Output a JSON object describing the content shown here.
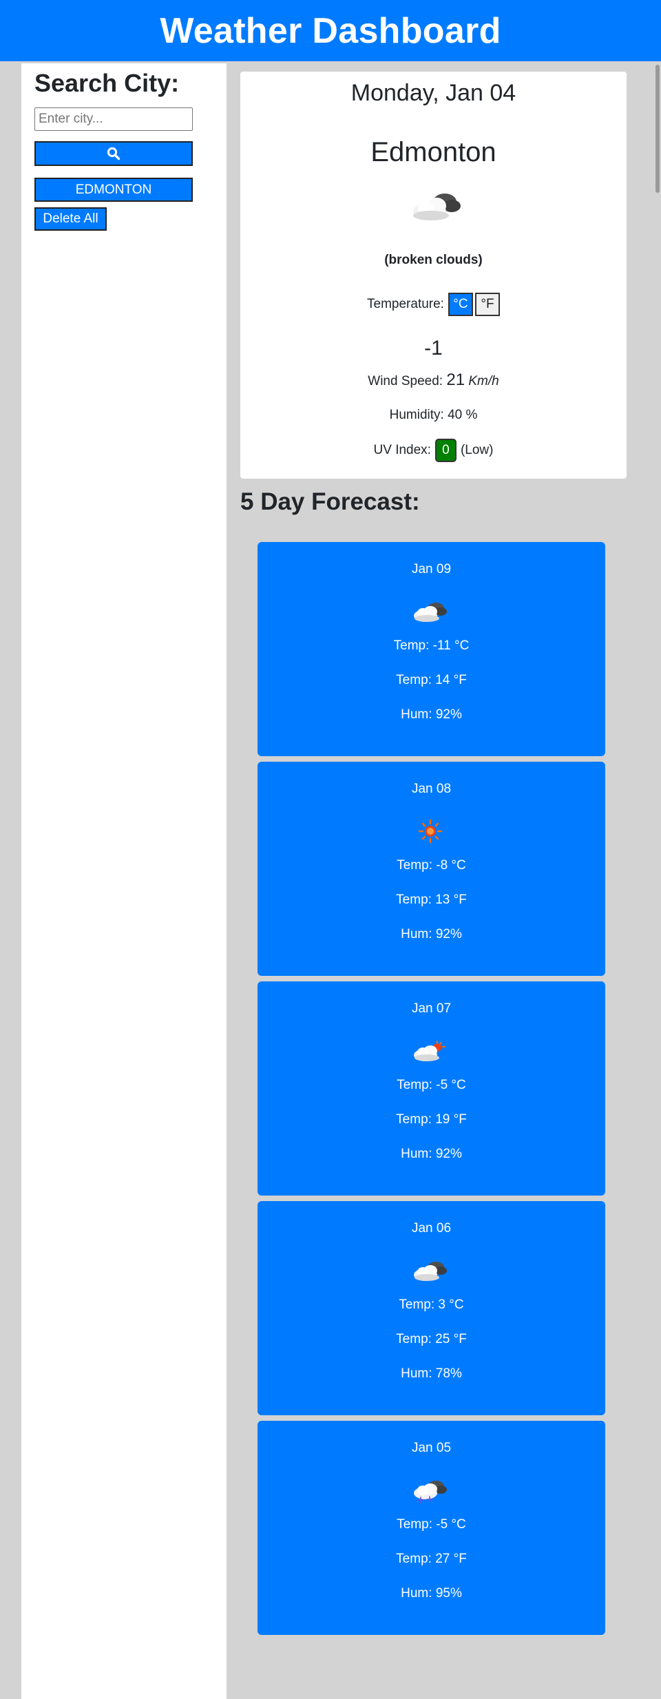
{
  "header": {
    "title": "Weather Dashboard"
  },
  "sidebar": {
    "heading": "Search City:",
    "search_placeholder": "Enter city...",
    "search_button_icon": "search-icon",
    "history": [
      "EDMONTON"
    ],
    "delete_all_label": "Delete All"
  },
  "current": {
    "date": "Monday, Jan 04",
    "city": "Edmonton",
    "icon": "broken-clouds-icon",
    "description": "(broken clouds)",
    "temperature_label": "Temperature:",
    "unit_celsius": "°C",
    "unit_fahrenheit": "°F",
    "active_unit": "celsius",
    "temperature_value": "-1",
    "wind_label": "Wind Speed:",
    "wind_value": "21",
    "wind_unit": "Km/h",
    "humidity_text": "Humidity: 40 %",
    "uv_label": "UV Index:",
    "uv_value": "0",
    "uv_level": "(Low)",
    "uv_color": "#008000"
  },
  "forecast": {
    "heading": "5 Day Forecast:",
    "days": [
      {
        "date": "Jan 09",
        "icon": "broken-clouds-icon",
        "temp_c": "Temp: -11 °C",
        "temp_f": "Temp: 14 °F",
        "hum": "Hum: 92%"
      },
      {
        "date": "Jan 08",
        "icon": "sun-icon",
        "temp_c": "Temp: -8 °C",
        "temp_f": "Temp: 13 °F",
        "hum": "Hum: 92%"
      },
      {
        "date": "Jan 07",
        "icon": "few-clouds-icon",
        "temp_c": "Temp: -5 °C",
        "temp_f": "Temp: 19 °F",
        "hum": "Hum: 92%"
      },
      {
        "date": "Jan 06",
        "icon": "broken-clouds-icon",
        "temp_c": "Temp: 3 °C",
        "temp_f": "Temp: 25 °F",
        "hum": "Hum: 78%"
      },
      {
        "date": "Jan 05",
        "icon": "snow-icon",
        "temp_c": "Temp: -5 °C",
        "temp_f": "Temp: 27 °F",
        "hum": "Hum: 95%"
      }
    ]
  },
  "colors": {
    "accent": "#007bff",
    "background": "#d3d3d3"
  }
}
